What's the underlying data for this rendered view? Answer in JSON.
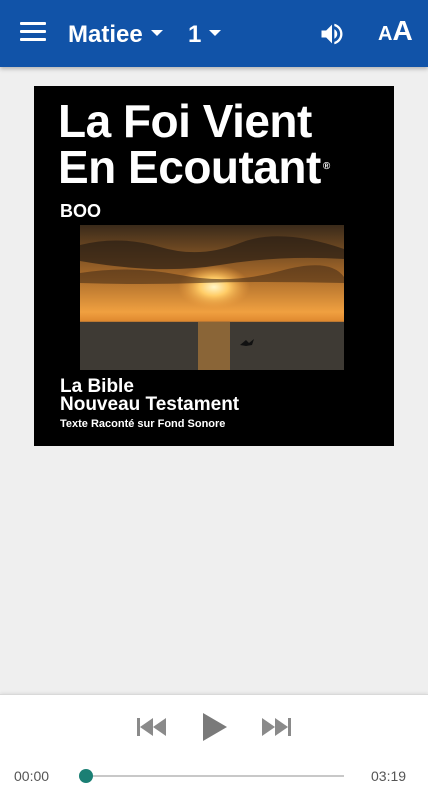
{
  "colors": {
    "appbar": "#1153a8",
    "accent": "#1b7f74"
  },
  "header": {
    "book": "Matiee",
    "chapter": "1",
    "icons": [
      "menu-icon",
      "volume-icon",
      "text-size-icon"
    ],
    "text_size_small": "A",
    "text_size_big": "A"
  },
  "cover": {
    "title_line1": "La Foi Vient",
    "title_line2": "En Ecoutant",
    "registered": "®",
    "code": "BOO",
    "subtitle1": "La Bible",
    "subtitle2": "Nouveau Testament",
    "subtitle3": "Texte Raconté sur Fond Sonore"
  },
  "player": {
    "current_time": "00:00",
    "total_time": "03:19",
    "progress": 0
  }
}
